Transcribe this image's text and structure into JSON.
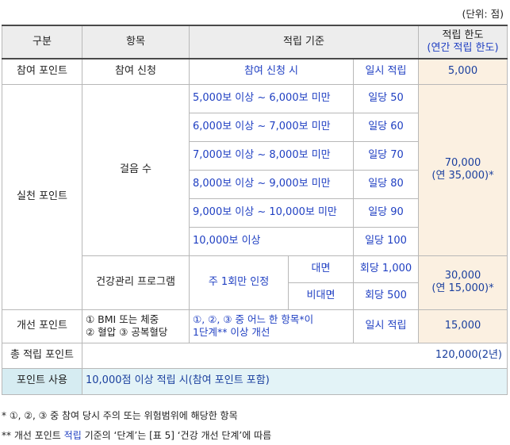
{
  "unit_label": "(단위: 점)",
  "header": {
    "category": "구분",
    "item": "항목",
    "criteria": "적립 기준",
    "limit_line1": "적립 한도",
    "limit_line2": "(연간 적립 한도)"
  },
  "participation": {
    "category": "참여 포인트",
    "item": "참여 신청",
    "criteria": "참여 신청 시",
    "rate": "일시 적립",
    "limit": "5,000"
  },
  "practice": {
    "category": "실천 포인트",
    "steps": {
      "item": "걸음 수",
      "rows": [
        {
          "criteria": "5,000보 이상 ~ 6,000보 미만",
          "rate": "일당 50"
        },
        {
          "criteria": "6,000보 이상 ~ 7,000보 미만",
          "rate": "일당 60"
        },
        {
          "criteria": "7,000보 이상 ~ 8,000보 미만",
          "rate": "일당 70"
        },
        {
          "criteria": "8,000보 이상 ~ 9,000보 미만",
          "rate": "일당 80"
        },
        {
          "criteria": "9,000보 이상 ~ 10,000보 미만",
          "rate": "일당 90"
        },
        {
          "criteria": "10,000보 이상",
          "rate": "일당 100"
        }
      ],
      "limit_line1": "70,000",
      "limit_line2": "(연 35,000)*"
    },
    "program": {
      "item": "건강관리 프로그램",
      "criteria": "주 1회만 인정",
      "rows": [
        {
          "mode": "대면",
          "rate": "회당 1,000"
        },
        {
          "mode": "비대면",
          "rate": "회당 500"
        }
      ],
      "limit_line1": "30,000",
      "limit_line2": "(연 15,000)*"
    }
  },
  "improvement": {
    "category": "개선 포인트",
    "item_line1": "① BMI 또는 체중",
    "item_line2": "② 혈압 ③ 공복혈당",
    "criteria_line1": "①, ②, ③ 중 어느 한 항목*이",
    "criteria_line2": "1단계** 이상 개선",
    "rate": "일시 적립",
    "limit": "15,000"
  },
  "total": {
    "label": "총 적립 포인트",
    "value": "120,000(2년)"
  },
  "usage": {
    "label": "포인트 사용",
    "value": "10,000점 이상 적립 시(참여 포인트 포함)"
  },
  "notes": {
    "note1": "* ①, ②, ③ 중 참여 당시 주의 또는 위험범위에 해당한 항목",
    "note2_prefix": "** 개선 포인트 ",
    "note2_highlight": "적립",
    "note2_suffix": " 기준의 ‘단계’는 [표 5] ‘건강 개선 단계’에 따름"
  }
}
